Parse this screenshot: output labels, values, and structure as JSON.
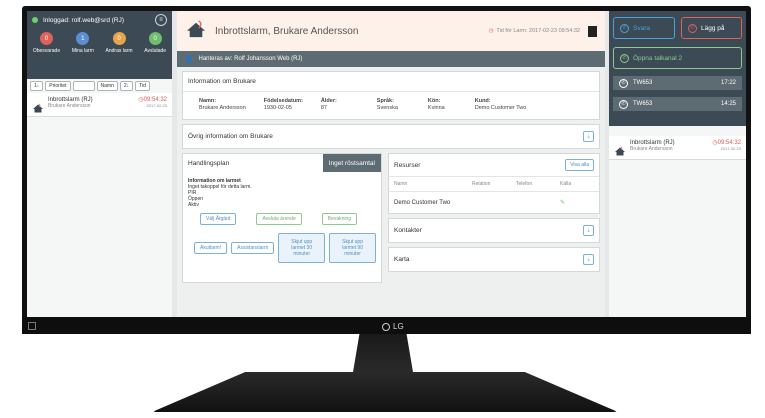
{
  "left": {
    "login_text": "Inloggad: rolf.web@srd (RJ)",
    "menu_icon": "menu-icon",
    "counters": [
      {
        "value": "0",
        "label": "Obesvarade",
        "color": "#e0605a"
      },
      {
        "value": "1",
        "label": "Mina larm",
        "color": "#5b8fd1"
      },
      {
        "value": "0",
        "label": "Andras larm",
        "color": "#e8a44a"
      },
      {
        "value": "0",
        "label": "Avslutade",
        "color": "#6fbf6f"
      }
    ],
    "sort_buttons": [
      "1↓",
      "Prioritet",
      "",
      "Namn",
      "2↓",
      "Tid"
    ],
    "alarm": {
      "title": "Inbrottslarm (RJ)",
      "sub": "Brukare Andersson",
      "time": "09:54:32",
      "date": "2017-02-23"
    }
  },
  "main": {
    "title": "Inbrottslarm,  Brukare Andersson",
    "time_label": "Tid för Larm:  2017-02-23 09:54:32",
    "handled_by": "Hanteras av: Rolf Johansson Web (RJ)",
    "info_card": {
      "title": "Information om Brukare",
      "fields": [
        {
          "label": "Namn:",
          "value": "Brukare Andersson"
        },
        {
          "label": "Födelsedatum:",
          "value": "1930-02-05"
        },
        {
          "label": "Ålder:",
          "value": "87"
        },
        {
          "label": "Språk:",
          "value": "Svenska"
        },
        {
          "label": "Kön:",
          "value": "Kvinna"
        },
        {
          "label": "Kund:",
          "value": "Demo Customer Two"
        }
      ]
    },
    "other_info_title": "Övrig information om Brukare",
    "action_plan": {
      "title": "Handlingsplan",
      "tab": "Inget röstsamtal",
      "heading": "Information om larmet",
      "lines": [
        "Inget takoppel för detta larm.",
        "PIR",
        "Öppen",
        "Aktiv"
      ],
      "btn_choose": "Välj Åtgärd",
      "btn_finish": "Avsluta ärende",
      "btn_confirm": "Bevakning",
      "btn_acute": "Akutlarm!",
      "btn_assist": "Assistanslarm",
      "btn_delay30": "Skjut upp larmet 30 minuter",
      "btn_delay90": "Skjut upp larmet 90 minuter"
    },
    "resources": {
      "title": "Resurser",
      "show_all": "Visa alla",
      "columns": [
        "Namn",
        "Relation",
        "Telefon",
        "Källa"
      ],
      "rows": [
        {
          "name": "Demo Customer Two"
        }
      ]
    },
    "contacts_title": "Kontakter",
    "map_title": "Karta"
  },
  "right": {
    "answer": "Svara",
    "hangup": "Lägg på",
    "open_call": "Öppna talkanal 2",
    "calls": [
      {
        "name": "TW653",
        "time": "17:22"
      },
      {
        "name": "TW653",
        "time": "14:25"
      }
    ],
    "alarm": {
      "title": "Inbrottslarm (RJ)",
      "sub": "Brukare Andersson",
      "time": "09:54:32",
      "date": "2017-02-23"
    }
  },
  "monitor": {
    "brand": "LG"
  },
  "colors": {
    "dark": "#3b4a54",
    "accent_blue": "#4aa3d8",
    "alert_red": "#e0605a",
    "ok_green": "#6fbf6f"
  }
}
